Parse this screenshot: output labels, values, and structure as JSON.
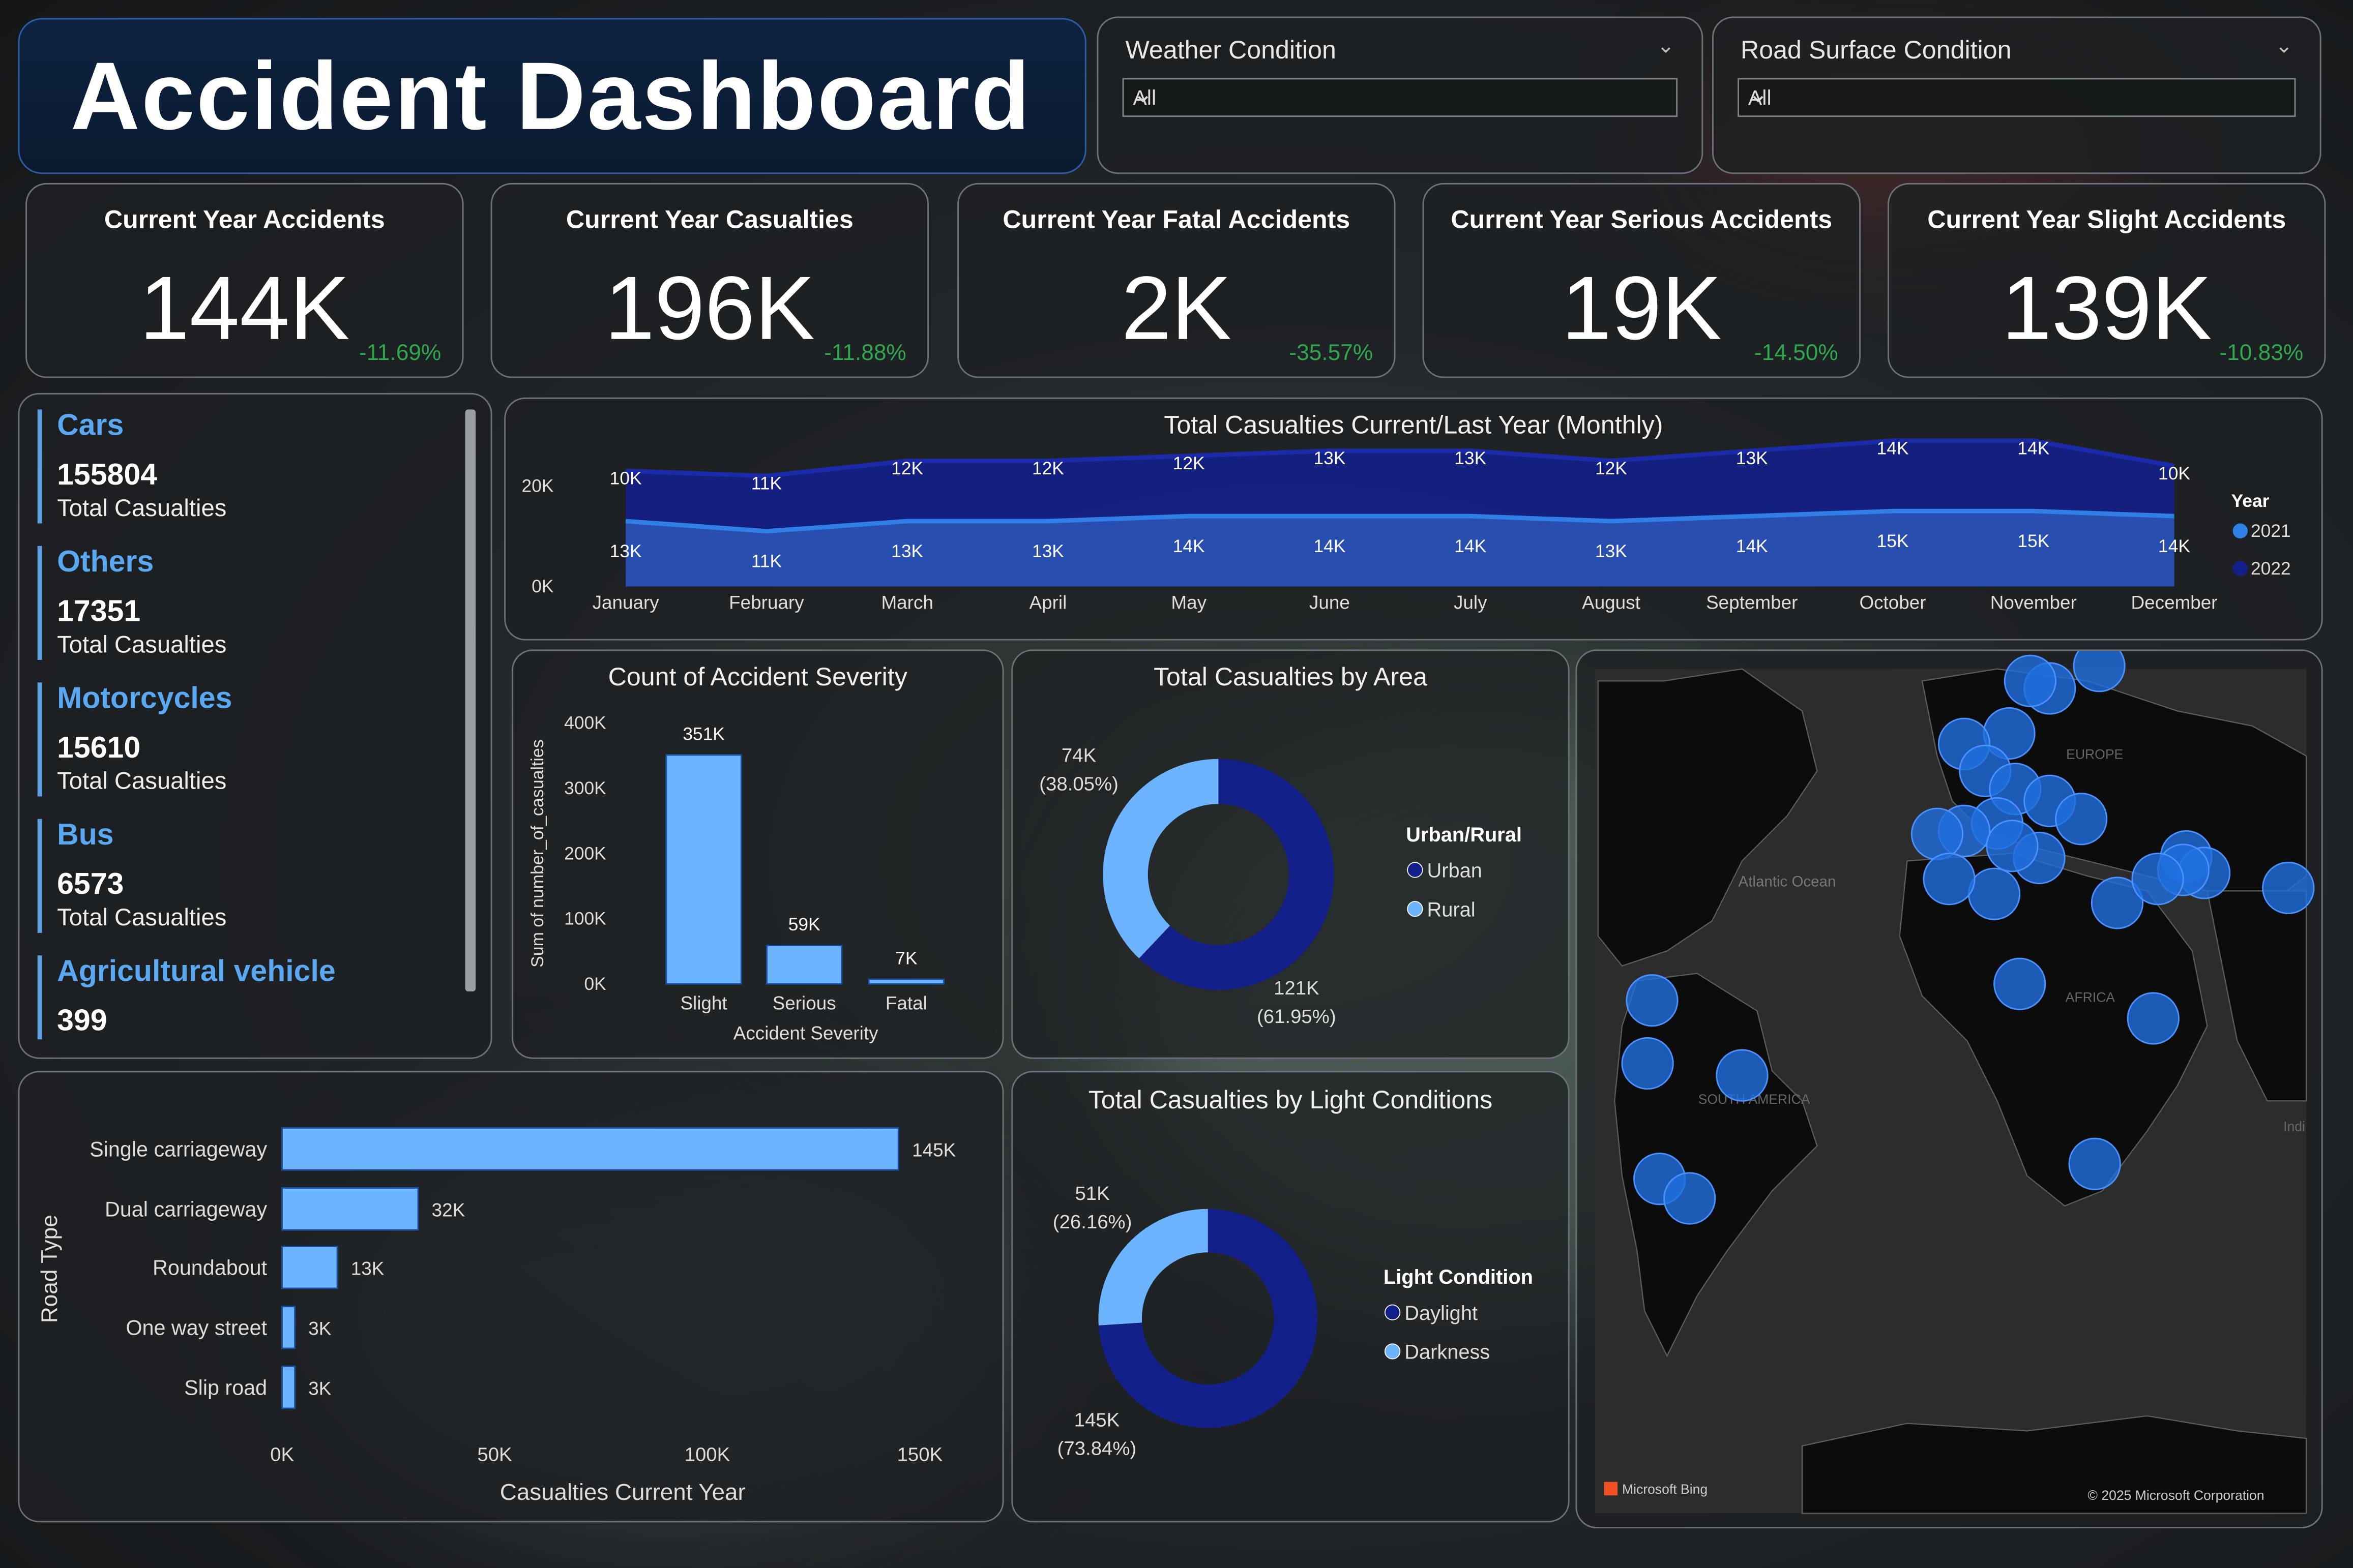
{
  "header": {
    "title": "Accident Dashboard"
  },
  "slicers": [
    {
      "label": "Weather Condition",
      "value": "All"
    },
    {
      "label": "Road Surface Condition",
      "value": "All"
    }
  ],
  "kpis": [
    {
      "title": "Current Year Accidents",
      "value": "144K",
      "change": "-11.69%"
    },
    {
      "title": "Current Year Casualties",
      "value": "196K",
      "change": "-11.88%"
    },
    {
      "title": "Current Year Fatal Accidents",
      "value": "2K",
      "change": "-35.57%"
    },
    {
      "title": "Current Year Serious Accidents",
      "value": "19K",
      "change": "-14.50%"
    },
    {
      "title": "Current Year Slight Accidents",
      "value": "139K",
      "change": "-10.83%"
    }
  ],
  "vehicles": [
    {
      "name": "Cars",
      "value": "155804",
      "sub": "Total Casualties"
    },
    {
      "name": "Others",
      "value": "17351",
      "sub": "Total Casualties"
    },
    {
      "name": "Motorcycles",
      "value": "15610",
      "sub": "Total Casualties"
    },
    {
      "name": "Bus",
      "value": "6573",
      "sub": "Total Casualties"
    },
    {
      "name": "Agricultural vehicle",
      "value": "399",
      "sub": ""
    }
  ],
  "colors": {
    "light_blue": "#6cb4ff",
    "dark_blue": "#1a2fa0",
    "navy": "#14208a",
    "accent": "#2f7fe6",
    "positive": "#2fa84f"
  },
  "chart_data": [
    {
      "type": "area",
      "title": "Total Casualties Current/Last Year (Monthly)",
      "categories": [
        "January",
        "February",
        "March",
        "April",
        "May",
        "June",
        "July",
        "August",
        "September",
        "October",
        "November",
        "December"
      ],
      "y_ticks": [
        "0K",
        "20K"
      ],
      "legend_title": "Year",
      "legend_position": "right",
      "series": [
        {
          "name": "2021",
          "values": [
            13,
            11,
            13,
            13,
            14,
            14,
            14,
            13,
            14,
            15,
            15,
            14
          ],
          "labels": [
            "13K",
            "11K",
            "13K",
            "13K",
            "14K",
            "14K",
            "14K",
            "13K",
            "14K",
            "15K",
            "15K",
            "14K"
          ],
          "color": "#2f7fe6"
        },
        {
          "name": "2022",
          "values": [
            10,
            11,
            12,
            12,
            12,
            13,
            13,
            12,
            13,
            14,
            14,
            10
          ],
          "labels": [
            "10K",
            "11K",
            "12K",
            "12K",
            "12K",
            "13K",
            "13K",
            "12K",
            "13K",
            "14K",
            "14K",
            "10K"
          ],
          "color": "#14208a"
        }
      ]
    },
    {
      "type": "bar",
      "title": "Count of Accident Severity",
      "categories": [
        "Slight",
        "Serious",
        "Fatal"
      ],
      "values": [
        351,
        59,
        7
      ],
      "labels": [
        "351K",
        "59K",
        "7K"
      ],
      "xlabel": "Accident Severity",
      "ylabel": "Sum of number_of_casualties",
      "y_ticks": [
        "0K",
        "100K",
        "200K",
        "300K",
        "400K"
      ],
      "ylim": [
        0,
        400
      ]
    },
    {
      "type": "pie",
      "title": "Total Casualties by Area",
      "legend_title": "Urban/Rural",
      "slices": [
        {
          "name": "Urban",
          "value": 121,
          "label": "121K",
          "pct": "(61.95%)",
          "color": "#14208a"
        },
        {
          "name": "Rural",
          "value": 74,
          "label": "74K",
          "pct": "(38.05%)",
          "color": "#6cb4ff"
        }
      ]
    },
    {
      "type": "bar",
      "orientation": "horizontal",
      "title": "",
      "categories": [
        "Single carriageway",
        "Dual carriageway",
        "Roundabout",
        "One way street",
        "Slip road"
      ],
      "values": [
        145,
        32,
        13,
        3,
        3
      ],
      "labels": [
        "145K",
        "32K",
        "13K",
        "3K",
        "3K"
      ],
      "xlabel": "Casualties Current Year",
      "ylabel": "Road Type",
      "x_ticks": [
        "0K",
        "50K",
        "100K",
        "150K"
      ],
      "xlim": [
        0,
        150
      ]
    },
    {
      "type": "pie",
      "title": "Total Casualties by Light Conditions",
      "legend_title": "Light Condition",
      "slices": [
        {
          "name": "Daylight",
          "value": 145,
          "label": "145K",
          "pct": "(73.84%)",
          "color": "#14208a"
        },
        {
          "name": "Darkness",
          "value": 51,
          "label": "51K",
          "pct": "(26.16%)",
          "color": "#6cb4ff"
        }
      ]
    }
  ],
  "map": {
    "labels": [
      "Atlantic Ocean",
      "EUROPE",
      "AFRICA",
      "SOUTH AMERICA",
      "Indi"
    ],
    "credit_left": "Microsoft Bing",
    "credit_right": "© 2025 Microsoft Corporation"
  }
}
